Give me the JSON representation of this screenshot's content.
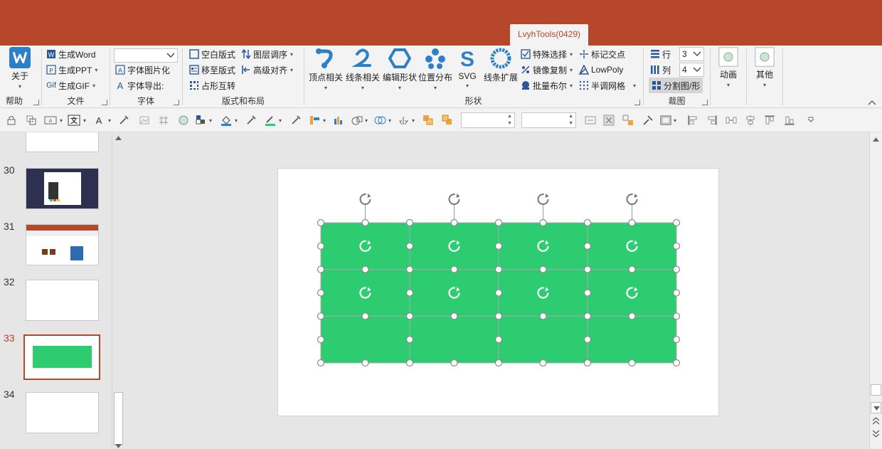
{
  "titlebar": {
    "addin_tab": "LvyhTools(0429)",
    "color": "#b7472a"
  },
  "ribbon": {
    "help": {
      "about_label": "关于",
      "group_label": "帮助"
    },
    "file": {
      "items": [
        "生成Word",
        "生成PPT",
        "生成GIF"
      ],
      "group_label": "文件"
    },
    "font": {
      "items": [
        "字体图片化",
        "字体导出:"
      ],
      "group_label": "字体"
    },
    "layout": {
      "items": [
        "空白版式",
        "移至版式",
        "占形互转",
        "图层调序",
        "高级对齐"
      ],
      "group_label": "版式和布局"
    },
    "shape": {
      "big_buttons": [
        "顶点相关",
        "线条相关",
        "编辑形状",
        "位置分布",
        "SVG",
        "线条扩展"
      ],
      "small_items": [
        "特殊选择",
        "镜像复制",
        "批量布尔",
        "标记交点",
        "LowPoly",
        "半调网格"
      ],
      "group_label": "形状"
    },
    "crop": {
      "row_label": "行",
      "row_value": "3",
      "col_label": "列",
      "col_value": "4",
      "split_button": "分割图/形",
      "group_label": "裁图"
    },
    "anim": {
      "label": "动画"
    },
    "other": {
      "label": "其他"
    }
  },
  "thumbnails": [
    {
      "number": "30"
    },
    {
      "number": "31"
    },
    {
      "number": "32"
    },
    {
      "number": "33",
      "active": true
    },
    {
      "number": "34"
    }
  ],
  "slide": {
    "shape_color": "#2ecc71",
    "grid": {
      "rows": 3,
      "cols": 4
    }
  }
}
